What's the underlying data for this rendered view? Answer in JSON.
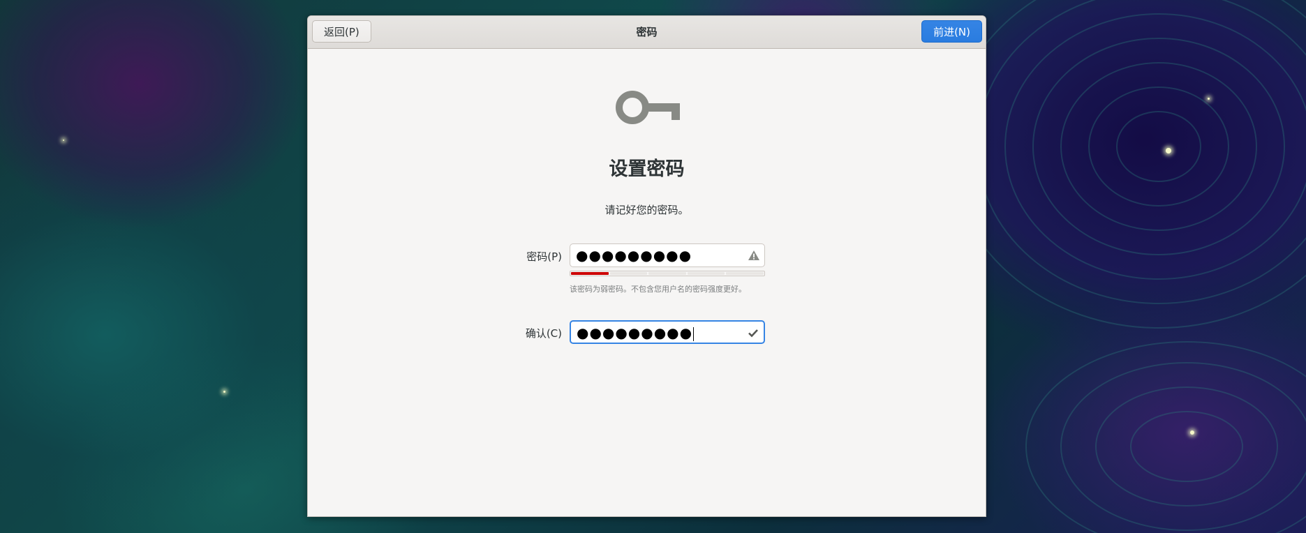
{
  "window": {
    "title": "密码",
    "back_label": "返回(P)",
    "next_label": "前进(N)"
  },
  "page": {
    "icon": "key-icon",
    "heading": "设置密码",
    "subtitle": "请记好您的密码。"
  },
  "password": {
    "label": "密码(P)",
    "value": "●●●●●●●●●",
    "status_icon": "warning-icon",
    "strength_level": 1,
    "strength_max": 5,
    "strength_color": "#cc0000",
    "hint": "该密码为弱密码。不包含您用户名的密码强度更好。"
  },
  "confirm": {
    "label": "确认(C)",
    "value": "●●●●●●●●●",
    "status_icon": "check-icon"
  },
  "colors": {
    "accent": "#3584e4",
    "dialog_bg": "#f6f5f4",
    "text": "#2e3436"
  }
}
